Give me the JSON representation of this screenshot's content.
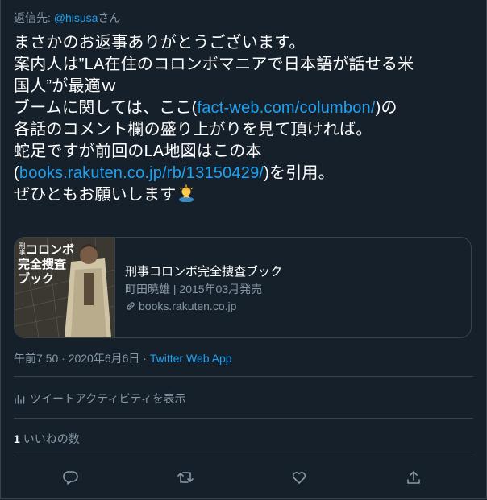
{
  "reply": {
    "prefix": "返信先: ",
    "handle": "@hisusa",
    "suffix": "さん"
  },
  "tweet": {
    "line1": "まさかのお返事ありがとうございます。",
    "line2": "案内人は”LA在住のコロンボマニアで日本語が話せる米",
    "line3": "国人”が最適ｗ",
    "line4_pre": "ブームに関しては、ここ(",
    "line4_link": "fact-web.com/columbon/",
    "line4_post": ")の",
    "line5": "各話のコメント欄の盛り上がりを見て頂ければ。",
    "line6": "蛇足ですが前回のLA地図はこの本",
    "line7_pre": "(",
    "line7_link": "books.rakuten.co.jp/rb/13150429/",
    "line7_post": ")を引用。",
    "line8": "ぜひともお願いします"
  },
  "card": {
    "image_text": {
      "small": "刑事",
      "line1": "コロンボ",
      "line2": "完全捜査",
      "line3": "ブック"
    },
    "title": "刑事コロンボ完全捜査ブック",
    "description": "町田暁雄 | 2015年03月発売",
    "url": "books.rakuten.co.jp"
  },
  "meta": {
    "time": "午前7:50 · 2020年6月6日 · ",
    "app": "Twitter Web App"
  },
  "activity_label": "ツイートアクティビティを表示",
  "likes": {
    "count": "1",
    "label": "いいねの数"
  },
  "actions": [
    "reply-icon",
    "retweet-icon",
    "like-icon",
    "share-icon"
  ],
  "colors": {
    "background": "#15202b",
    "accent": "#1da1f2",
    "muted": "#8899a6",
    "border": "#38444d"
  }
}
